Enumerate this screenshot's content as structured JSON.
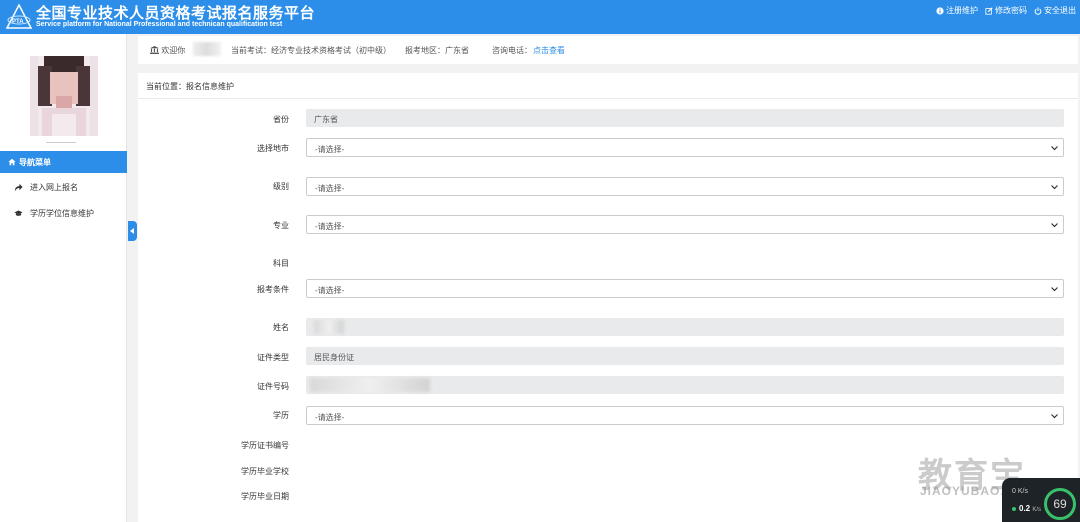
{
  "header": {
    "title_cn": "全国专业技术人员资格考试报名服务平台",
    "title_en": "Service platform for National Professional and technican qualification test",
    "links": [
      "注册维护",
      "修改密码",
      "安全退出"
    ]
  },
  "sidebar": {
    "nav_header": "导航菜单",
    "items": [
      "进入网上报名",
      "学历学位信息维护"
    ]
  },
  "infobar": {
    "welcome": "欢迎你",
    "exam_label": "当前考试：",
    "exam_value": "经济专业技术资格考试（初中级）",
    "region_label": "报考地区：",
    "region_value": "广东省",
    "phone_label": "咨询电话：",
    "phone_link": "点击查看"
  },
  "breadcrumb": "当前位置：报名信息维护",
  "form": {
    "province_label": "省份",
    "province_value": "广东省",
    "city_label": "选择地市",
    "city_value": "-请选择-",
    "level_label": "级别",
    "level_value": "-请选择-",
    "major_label": "专业",
    "major_value": "-请选择-",
    "subject_label": "科目",
    "condition_label": "报考条件",
    "condition_value": "-请选择-",
    "name_label": "姓名",
    "idtype_label": "证件类型",
    "idtype_value": "居民身份证",
    "idno_label": "证件号码",
    "edu_label": "学历",
    "edu_value": "-请选择-",
    "edu_cert_label": "学历证书编号",
    "school_label": "学历毕业学校",
    "grad_date_label": "学历毕业日期"
  },
  "watermark": {
    "cn": "教育宝",
    "en": "JIAOYUBAO.CN"
  },
  "speed": {
    "up": "0 K/s",
    "down": "0.2",
    "down_unit": "K/s",
    "percent": "69"
  },
  "colors": {
    "primary": "#2c8ee8",
    "link": "#2c8ee8"
  }
}
